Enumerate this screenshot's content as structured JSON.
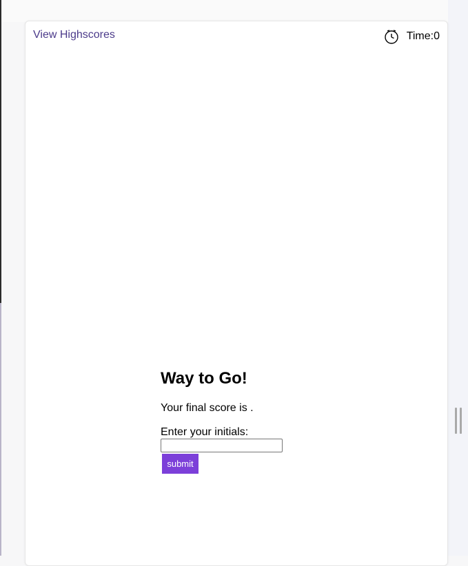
{
  "header": {
    "highscores_link": "View Highscores",
    "timer_label": "Time:",
    "timer_value": "0",
    "timer_icon": "clock-icon"
  },
  "result": {
    "title": "Way to Go!",
    "final_score_prefix": "Your final score is",
    "final_score_value": "",
    "final_score_suffix": ".",
    "initials_label": "Enter your initials:",
    "initials_value": "",
    "submit_label": "submit"
  },
  "colors": {
    "link": "#4b3a8a",
    "button": "#7c3fd9",
    "button_text": "#ffffff"
  }
}
